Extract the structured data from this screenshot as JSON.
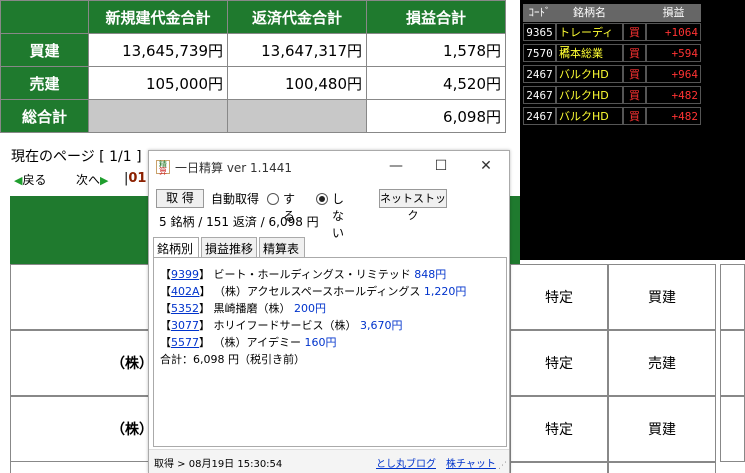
{
  "summary": {
    "headers": [
      "新規建代金合計",
      "返済代金合計",
      "損益合計"
    ],
    "rows": [
      {
        "label": "買建",
        "values": [
          "13,645,739円",
          "13,647,317円",
          "1,578円"
        ]
      },
      {
        "label": "売建",
        "values": [
          "105,000円",
          "100,480円",
          "4,520円"
        ]
      },
      {
        "label": "総合計",
        "values": [
          "",
          "",
          "6,098円"
        ]
      }
    ]
  },
  "ranking": {
    "headers": [
      "ｺｰﾄﾞ",
      "銘柄名",
      "",
      "損益"
    ],
    "rows": [
      {
        "code": "9365",
        "name": "トレーディア",
        "side": "買",
        "pl": "+1064"
      },
      {
        "code": "7570",
        "name": "橋本総業",
        "side": "買",
        "pl": "+594"
      },
      {
        "code": "2467",
        "name": "バルクHD",
        "side": "買",
        "pl": "+964"
      },
      {
        "code": "2467",
        "name": "バルクHD",
        "side": "買",
        "pl": "+482"
      },
      {
        "code": "2467",
        "name": "バルクHD",
        "side": "買",
        "pl": "+482"
      }
    ]
  },
  "nav": {
    "page_indicator": "現在のページ [ 1/1 ]",
    "back": "戻る",
    "next": "次へ",
    "sep": "01"
  },
  "detail": {
    "rows": [
      {
        "label": "",
        "type": "特定",
        "side": "買建"
      },
      {
        "label": "（株）",
        "type": "特定",
        "side": "売建"
      },
      {
        "label": "（株）",
        "type": "特定",
        "side": "買建"
      }
    ]
  },
  "popup": {
    "icon_text_top": "精",
    "icon_text_bottom": "算",
    "title": "一日精算 ver 1.1441",
    "controls": {
      "min": "—",
      "max": "☐",
      "close": "✕"
    },
    "toolbar": {
      "get_label": "取 得",
      "auto_label": "自動取得",
      "on_label": "する",
      "off_label": "しない",
      "net_label": "ネットストック"
    },
    "stats": "5 銘柄 / 151 返済 / 6,098 円",
    "tabs": [
      "銘柄別",
      "損益推移",
      "精算表"
    ],
    "items": [
      {
        "code": "9399",
        "name": "ビート・ホールディングス・リミテッド",
        "price": "848円"
      },
      {
        "code": "402A",
        "name": "（株）アクセルスペースホールディングス",
        "price": "1,220円"
      },
      {
        "code": "5352",
        "name": "黒崎播磨（株）",
        "price": "200円"
      },
      {
        "code": "3077",
        "name": "ホリイフードサービス（株）",
        "price": "3,670円"
      },
      {
        "code": "5577",
        "name": "（株）アイデミー",
        "price": "160円"
      }
    ],
    "total": "合計：6,098 円（税引き前）",
    "status": "取得 > 08月19日 15:30:54",
    "link_blog": "とし丸ブログ",
    "link_chart": "株チャット",
    "grip": "⋰"
  }
}
